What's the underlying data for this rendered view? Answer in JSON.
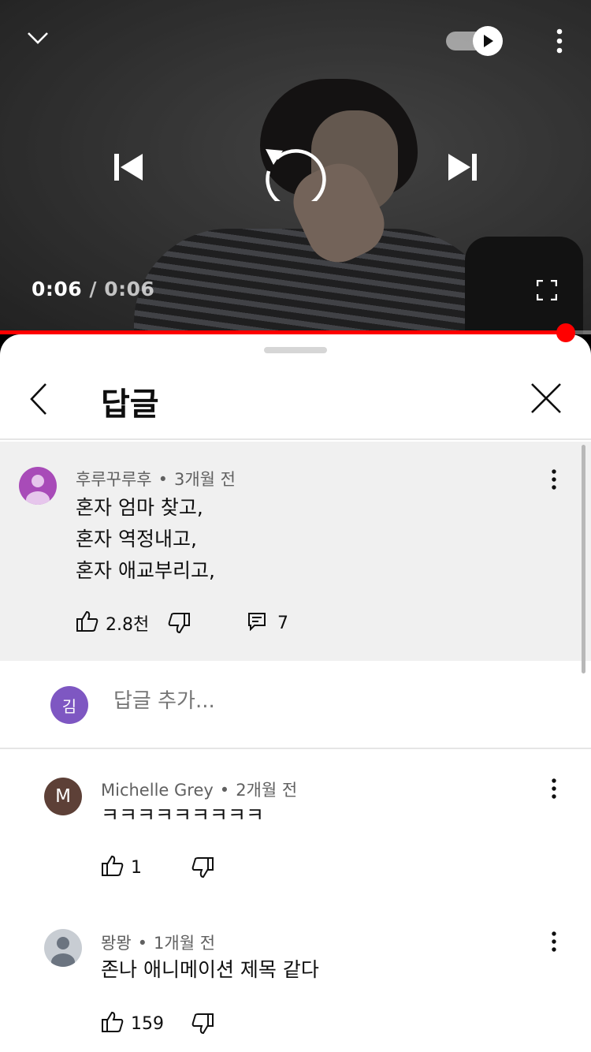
{
  "player": {
    "current_time": "0:06",
    "separator": "/",
    "duration": "0:06",
    "progress_fraction": 0.955,
    "autoplay_on": true,
    "icons": [
      "chevron-down-icon",
      "autoplay-toggle",
      "kebab-menu-icon",
      "skip-previous-icon",
      "replay-icon",
      "skip-next-icon",
      "fullscreen-icon"
    ]
  },
  "sheet": {
    "title": "답글"
  },
  "parent_comment": {
    "author": "후루꾸루후",
    "time": "3개월 전",
    "lines": [
      "혼자 엄마 찾고,",
      "혼자 역정내고,",
      "혼자 애교부리고,"
    ],
    "likes": "2.8천",
    "replies": "7",
    "avatar_color": "#a84bb8"
  },
  "add_reply": {
    "avatar_letter": "김",
    "avatar_color": "#7e57c2",
    "placeholder": "답글 추가..."
  },
  "replies": [
    {
      "author": "Michelle Grey",
      "time": "2개월 전",
      "text": "ㅋㅋㅋㅋㅋㅋㅋㅋㅋ",
      "likes": "1",
      "avatar_letter": "M",
      "avatar_color": "#5d4037"
    },
    {
      "author": "뫙뫙",
      "time": "1개월 전",
      "text": "존나 애니메이션 제목 같다",
      "likes": "159",
      "avatar_color": "#c8cdd3"
    }
  ],
  "colors": {
    "accent_red": "#ff0000",
    "text_primary": "#0f0f0f",
    "text_secondary": "#606060",
    "highlight_bg": "#f0f0f0"
  }
}
